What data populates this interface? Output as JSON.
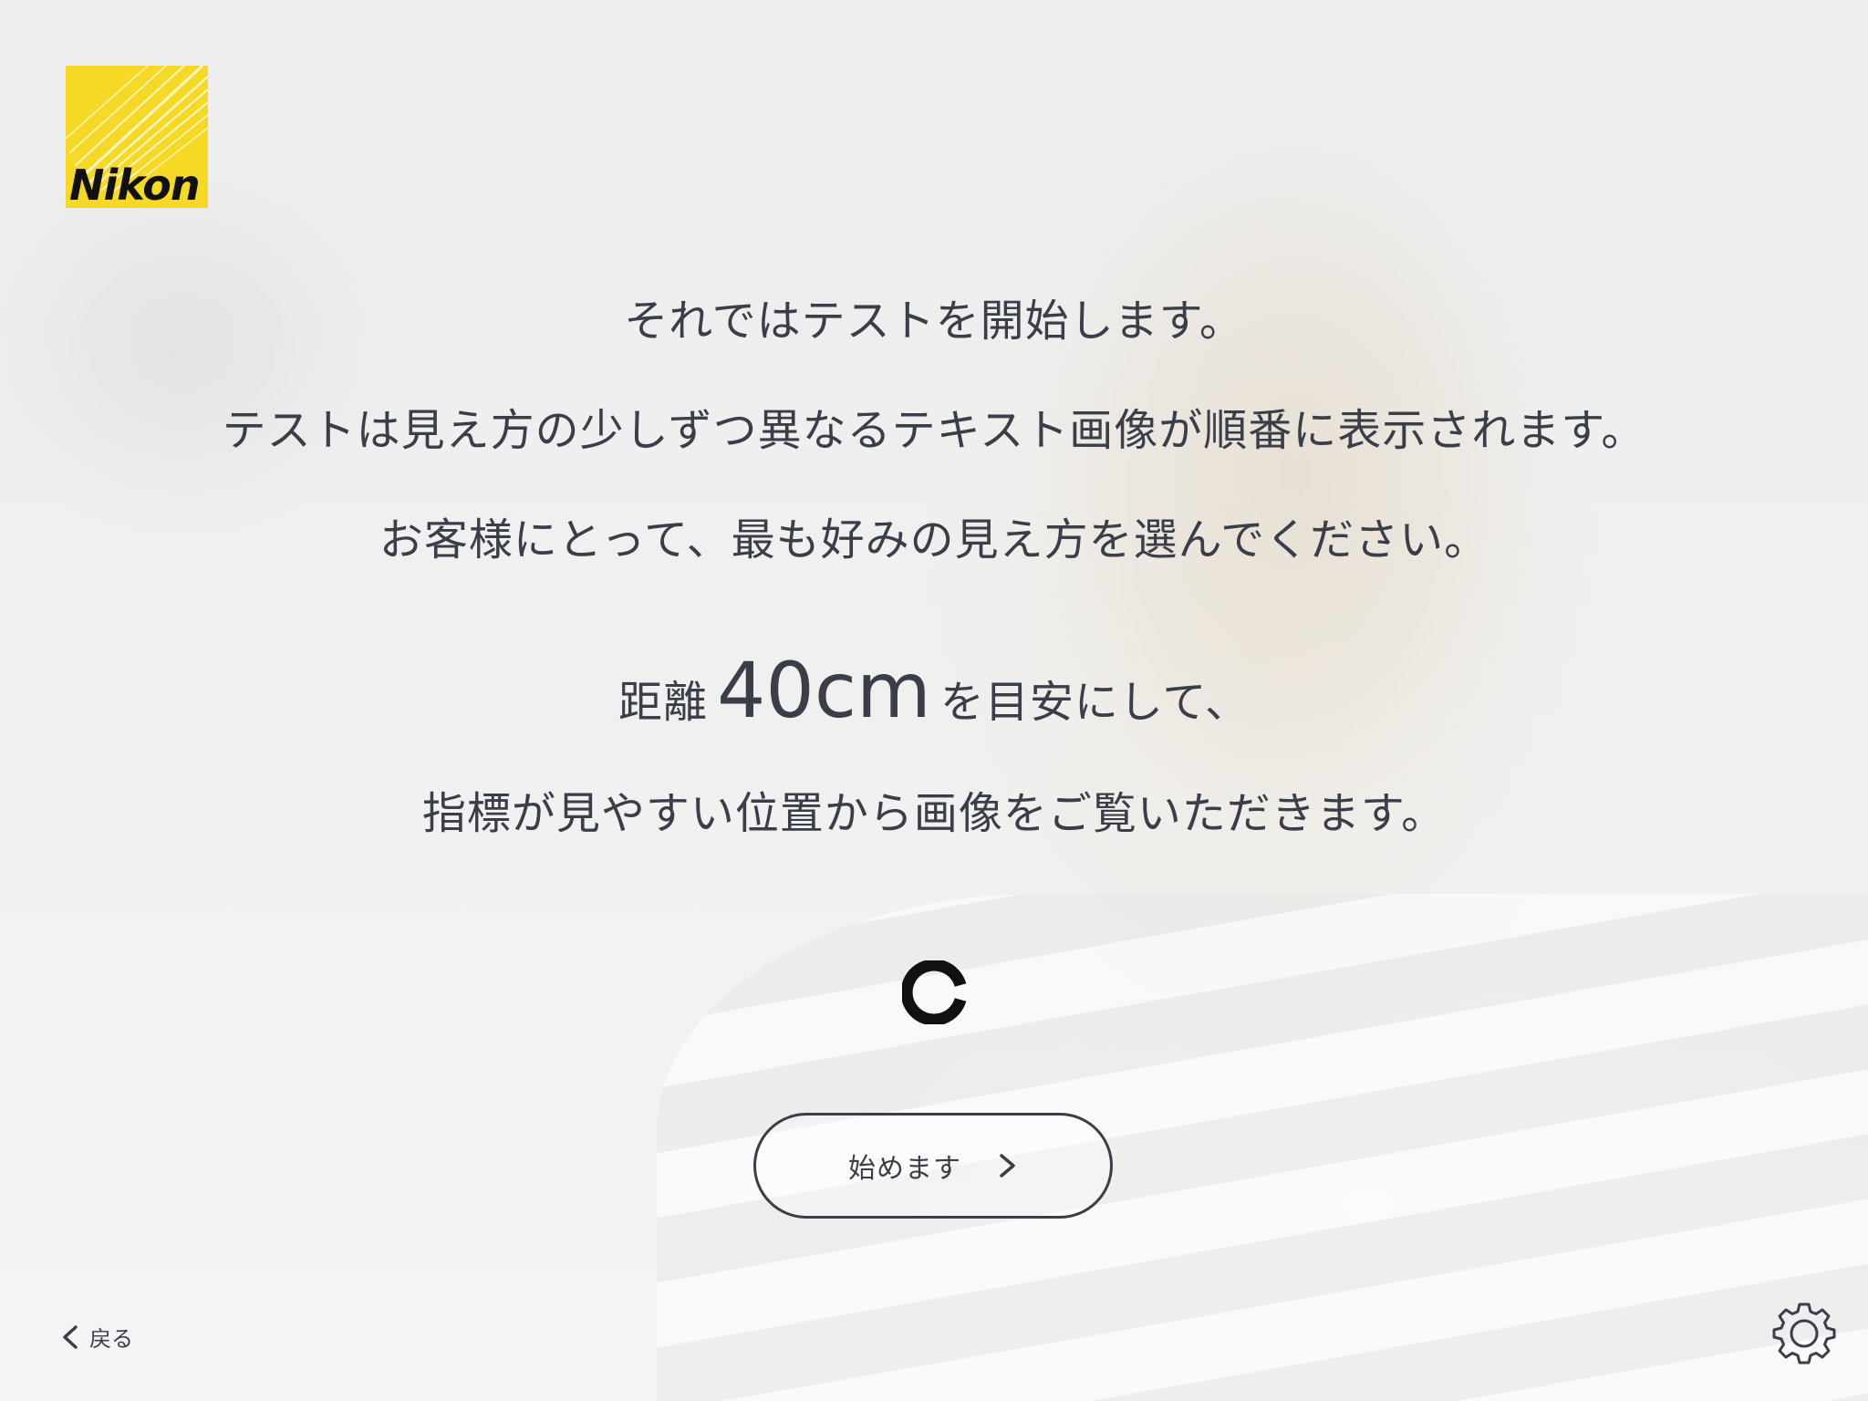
{
  "brand": {
    "logo_text": "Nikon",
    "logo_color": "#f6d925"
  },
  "intro": {
    "line1": "それではテストを開始します。",
    "line2": "テストは見え方の少しずつ異なるテキスト画像が順番に表示されます。",
    "line3": "お客様にとって、最も好みの見え方を選んでください。",
    "distance_prefix": "距離",
    "distance_value": "40cm",
    "distance_suffix": "を目安にして、",
    "line5": "指標が見やすい位置から画像をご覧いただきます。"
  },
  "target": {
    "icon": "landolt-c-icon"
  },
  "start_button": {
    "label": "始めます",
    "icon": "chevron-right-icon"
  },
  "back": {
    "label": "戻る",
    "icon": "chevron-left-icon"
  },
  "settings": {
    "icon": "gear-icon"
  },
  "colors": {
    "text": "#3a3e48",
    "background": "#efefef"
  }
}
